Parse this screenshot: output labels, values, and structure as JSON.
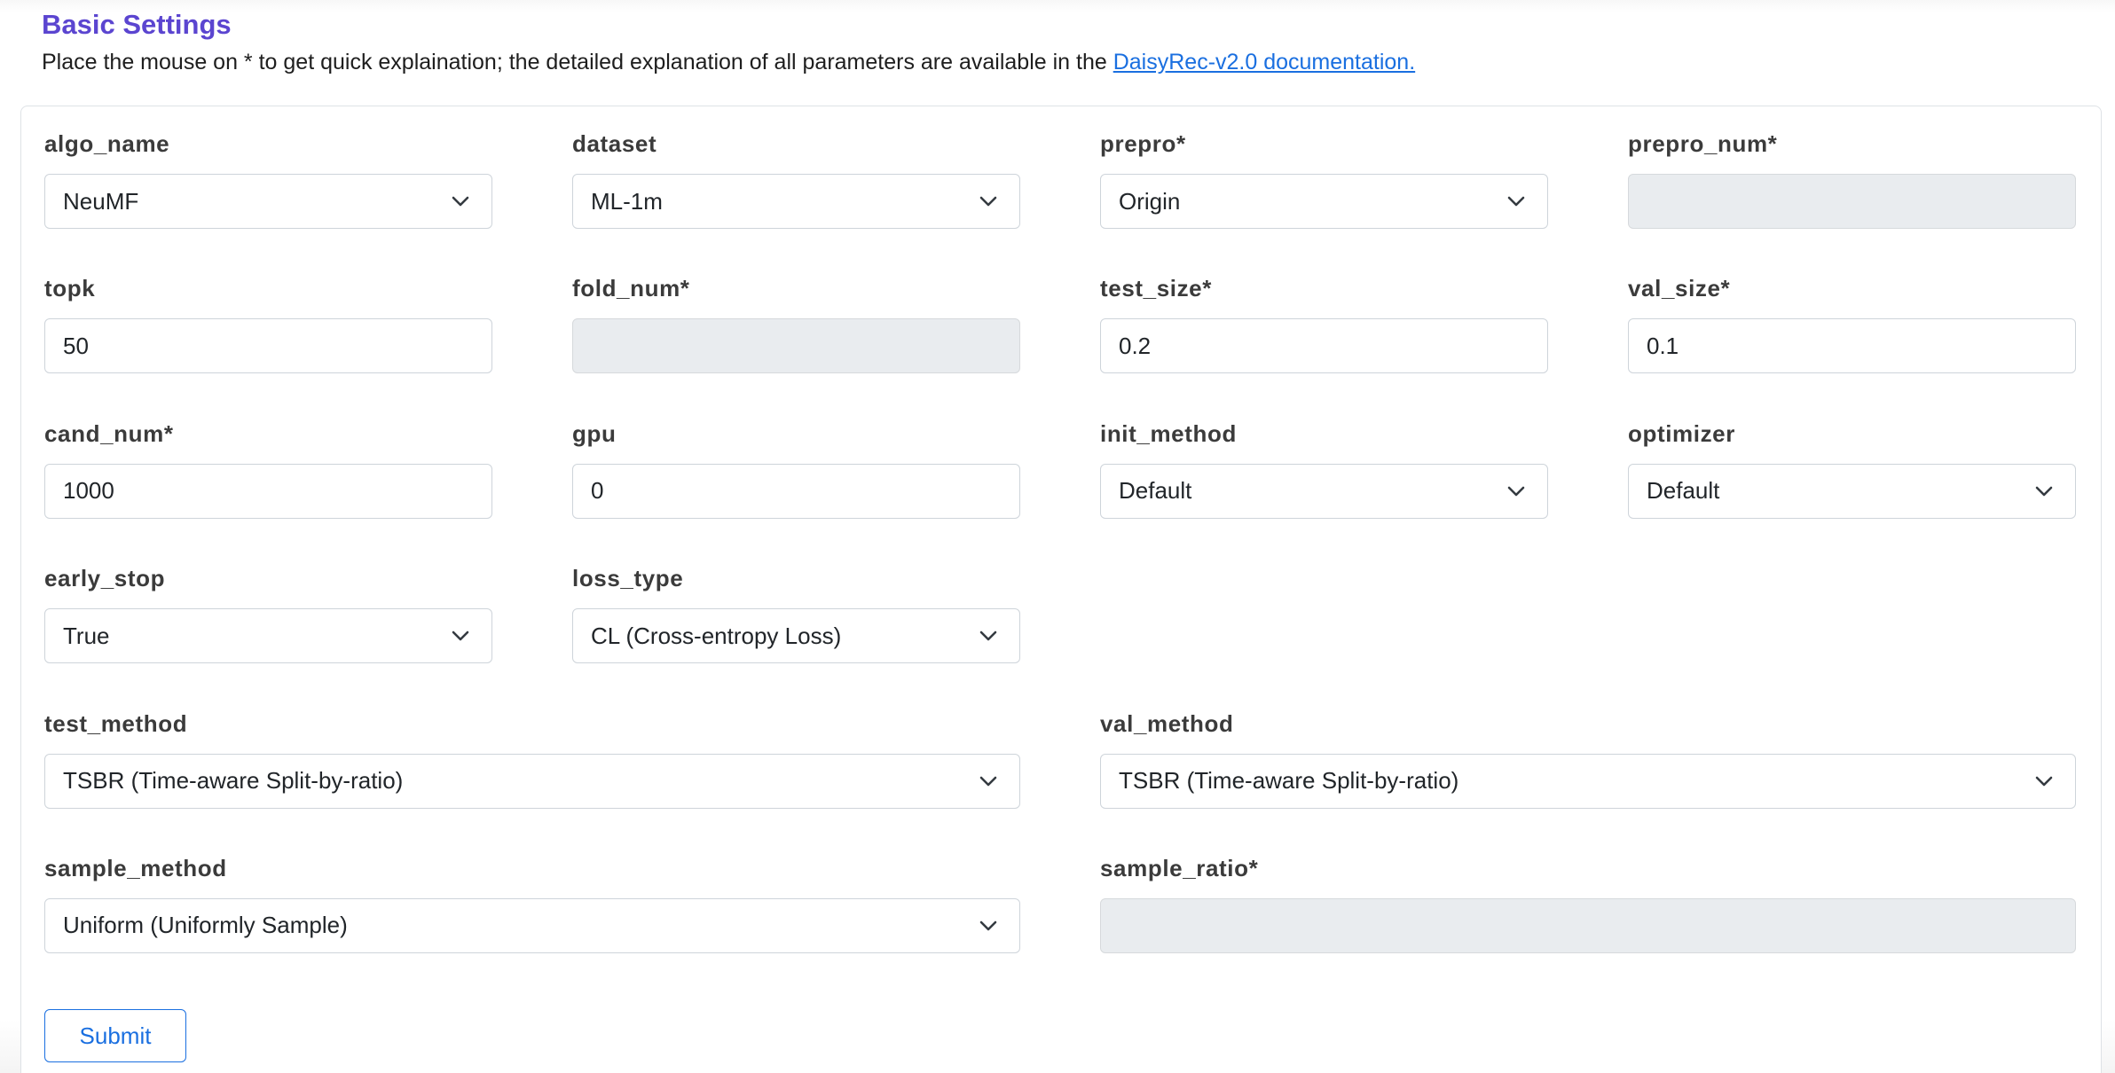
{
  "header": {
    "title": "Basic Settings",
    "hint_text": "Place the mouse on * to get quick explaination; the detailed explanation of all parameters are available in the ",
    "doc_link": "DaisyRec-v2.0 documentation."
  },
  "fields": {
    "algo_name": {
      "label": "algo_name",
      "value": "NeuMF"
    },
    "dataset": {
      "label": "dataset",
      "value": "ML-1m"
    },
    "prepro": {
      "label": "prepro*",
      "value": "Origin"
    },
    "prepro_num": {
      "label": "prepro_num*",
      "value": ""
    },
    "topk": {
      "label": "topk",
      "value": "50"
    },
    "fold_num": {
      "label": "fold_num*",
      "value": ""
    },
    "test_size": {
      "label": "test_size*",
      "value": "0.2"
    },
    "val_size": {
      "label": "val_size*",
      "value": "0.1"
    },
    "cand_num": {
      "label": "cand_num*",
      "value": "1000"
    },
    "gpu": {
      "label": "gpu",
      "value": "0"
    },
    "init_method": {
      "label": "init_method",
      "value": "Default"
    },
    "optimizer": {
      "label": "optimizer",
      "value": "Default"
    },
    "early_stop": {
      "label": "early_stop",
      "value": "True"
    },
    "loss_type": {
      "label": "loss_type",
      "value": "CL (Cross-entropy Loss)"
    },
    "test_method": {
      "label": "test_method",
      "value": "TSBR (Time-aware Split-by-ratio)"
    },
    "val_method": {
      "label": "val_method",
      "value": "TSBR (Time-aware Split-by-ratio)"
    },
    "sample_method": {
      "label": "sample_method",
      "value": "Uniform (Uniformly Sample)"
    },
    "sample_ratio": {
      "label": "sample_ratio*",
      "value": ""
    }
  },
  "actions": {
    "submit_label": "Submit"
  },
  "icons": {
    "dropdown": "chevron-down-icon"
  },
  "colors": {
    "title": "#5b45d0",
    "link": "#1a6fe0",
    "disabled_bg": "#e9ecef",
    "border": "#ced4da"
  }
}
